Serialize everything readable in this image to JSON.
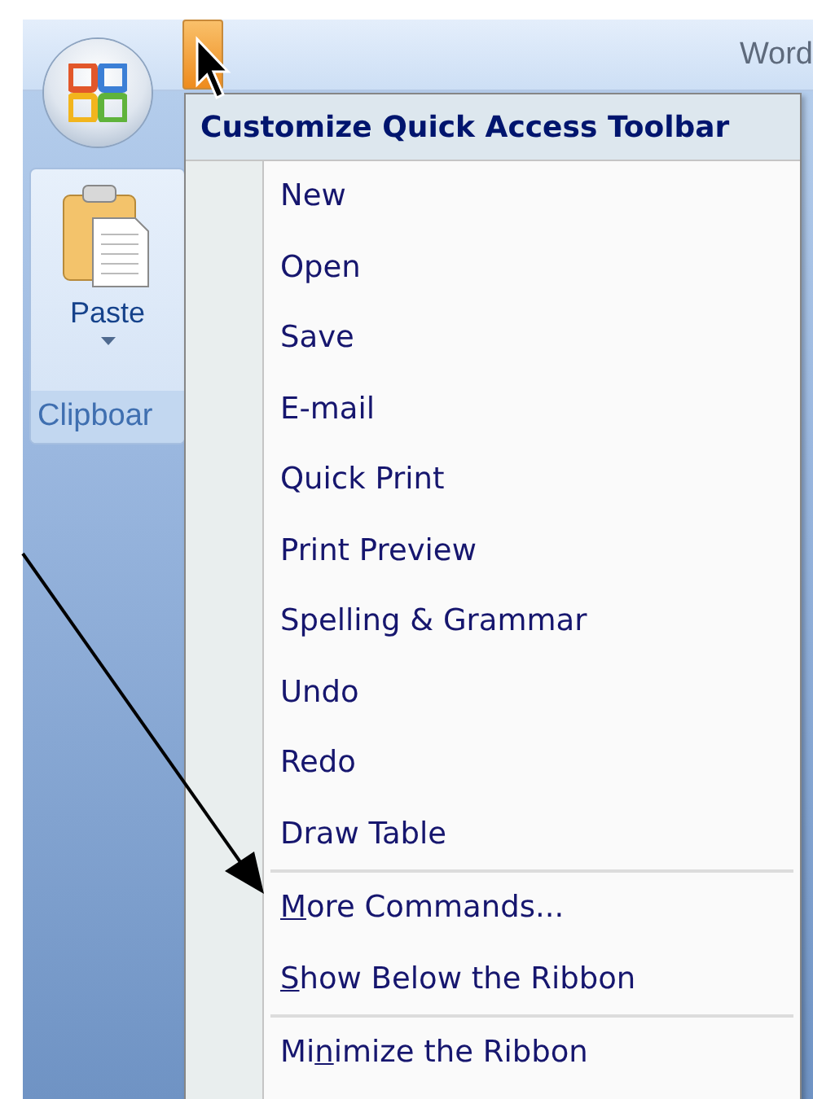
{
  "window": {
    "title": "Word"
  },
  "ribbon": {
    "groups": [
      {
        "label": "Clipboar",
        "buttons": [
          {
            "label": "Paste",
            "dropdown": true
          }
        ]
      }
    ]
  },
  "menu": {
    "title": "Customize Quick Access Toolbar",
    "items": [
      {
        "before": "New",
        "separator_before": false
      },
      {
        "before": "Open",
        "separator_before": false
      },
      {
        "before": "Save",
        "separator_before": false
      },
      {
        "before": "E-mail",
        "separator_before": false
      },
      {
        "before": "Quick Print",
        "separator_before": false
      },
      {
        "before": "Print Preview",
        "separator_before": false
      },
      {
        "before": "Spelling & Grammar",
        "separator_before": false
      },
      {
        "before": "Undo",
        "separator_before": false
      },
      {
        "before": "Redo",
        "separator_before": false
      },
      {
        "before": "Draw Table",
        "separator_before": false
      },
      {
        "key": "M",
        "after": "ore Commands...",
        "separator_before": true
      },
      {
        "key": "S",
        "after": "how Below the Ribbon",
        "separator_before": false
      },
      {
        "before": "Mi",
        "key": "n",
        "after": "imize the Ribbon",
        "separator_before": true
      }
    ]
  }
}
